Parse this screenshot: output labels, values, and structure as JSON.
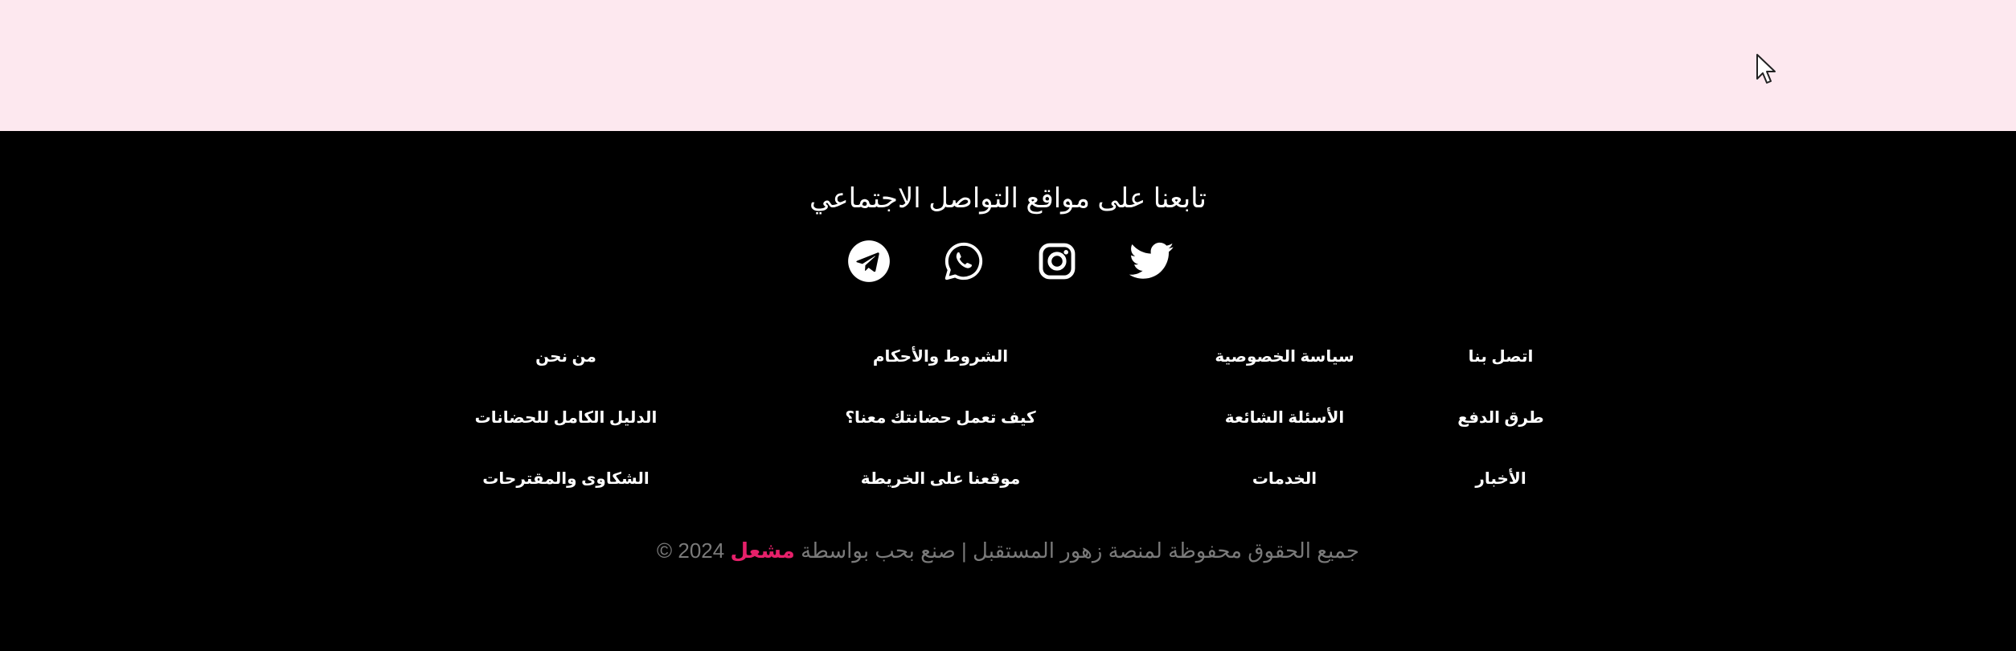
{
  "footer": {
    "follow_title": "تابعنا على مواقع التواصل الاجتماعي",
    "social_icons": [
      "twitter-icon",
      "instagram-icon",
      "whatsapp-icon",
      "telegram-icon"
    ],
    "links": {
      "contact_us": "اتصل بنا",
      "privacy_policy": "سياسة الخصوصية",
      "terms": "الشروط والأحكام",
      "about_us": "من نحن",
      "payment_methods": "طرق الدفع",
      "faq": "الأسئلة الشائعة",
      "how_nurseries_work": "كيف تعمل حضانتك معنا؟",
      "nursery_guide": "الدليل الكامل للحضانات",
      "news": "الأخبار",
      "services": "الخدمات",
      "map_location": "موقعنا على الخريطة",
      "complaints": "الشكاوى والمقترحات"
    },
    "copyright_text": "جميع الحقوق محفوظة لمنصة زهور المستقبل | صنع بحب بواسطة",
    "copyright_brand": "مشعل",
    "copyright_year": "2024 ©"
  },
  "colors": {
    "top_band": "#fde8ef",
    "footer_bg": "#000000",
    "brand_accent": "#e6206a",
    "copyright_gray": "#7a7a7a"
  }
}
